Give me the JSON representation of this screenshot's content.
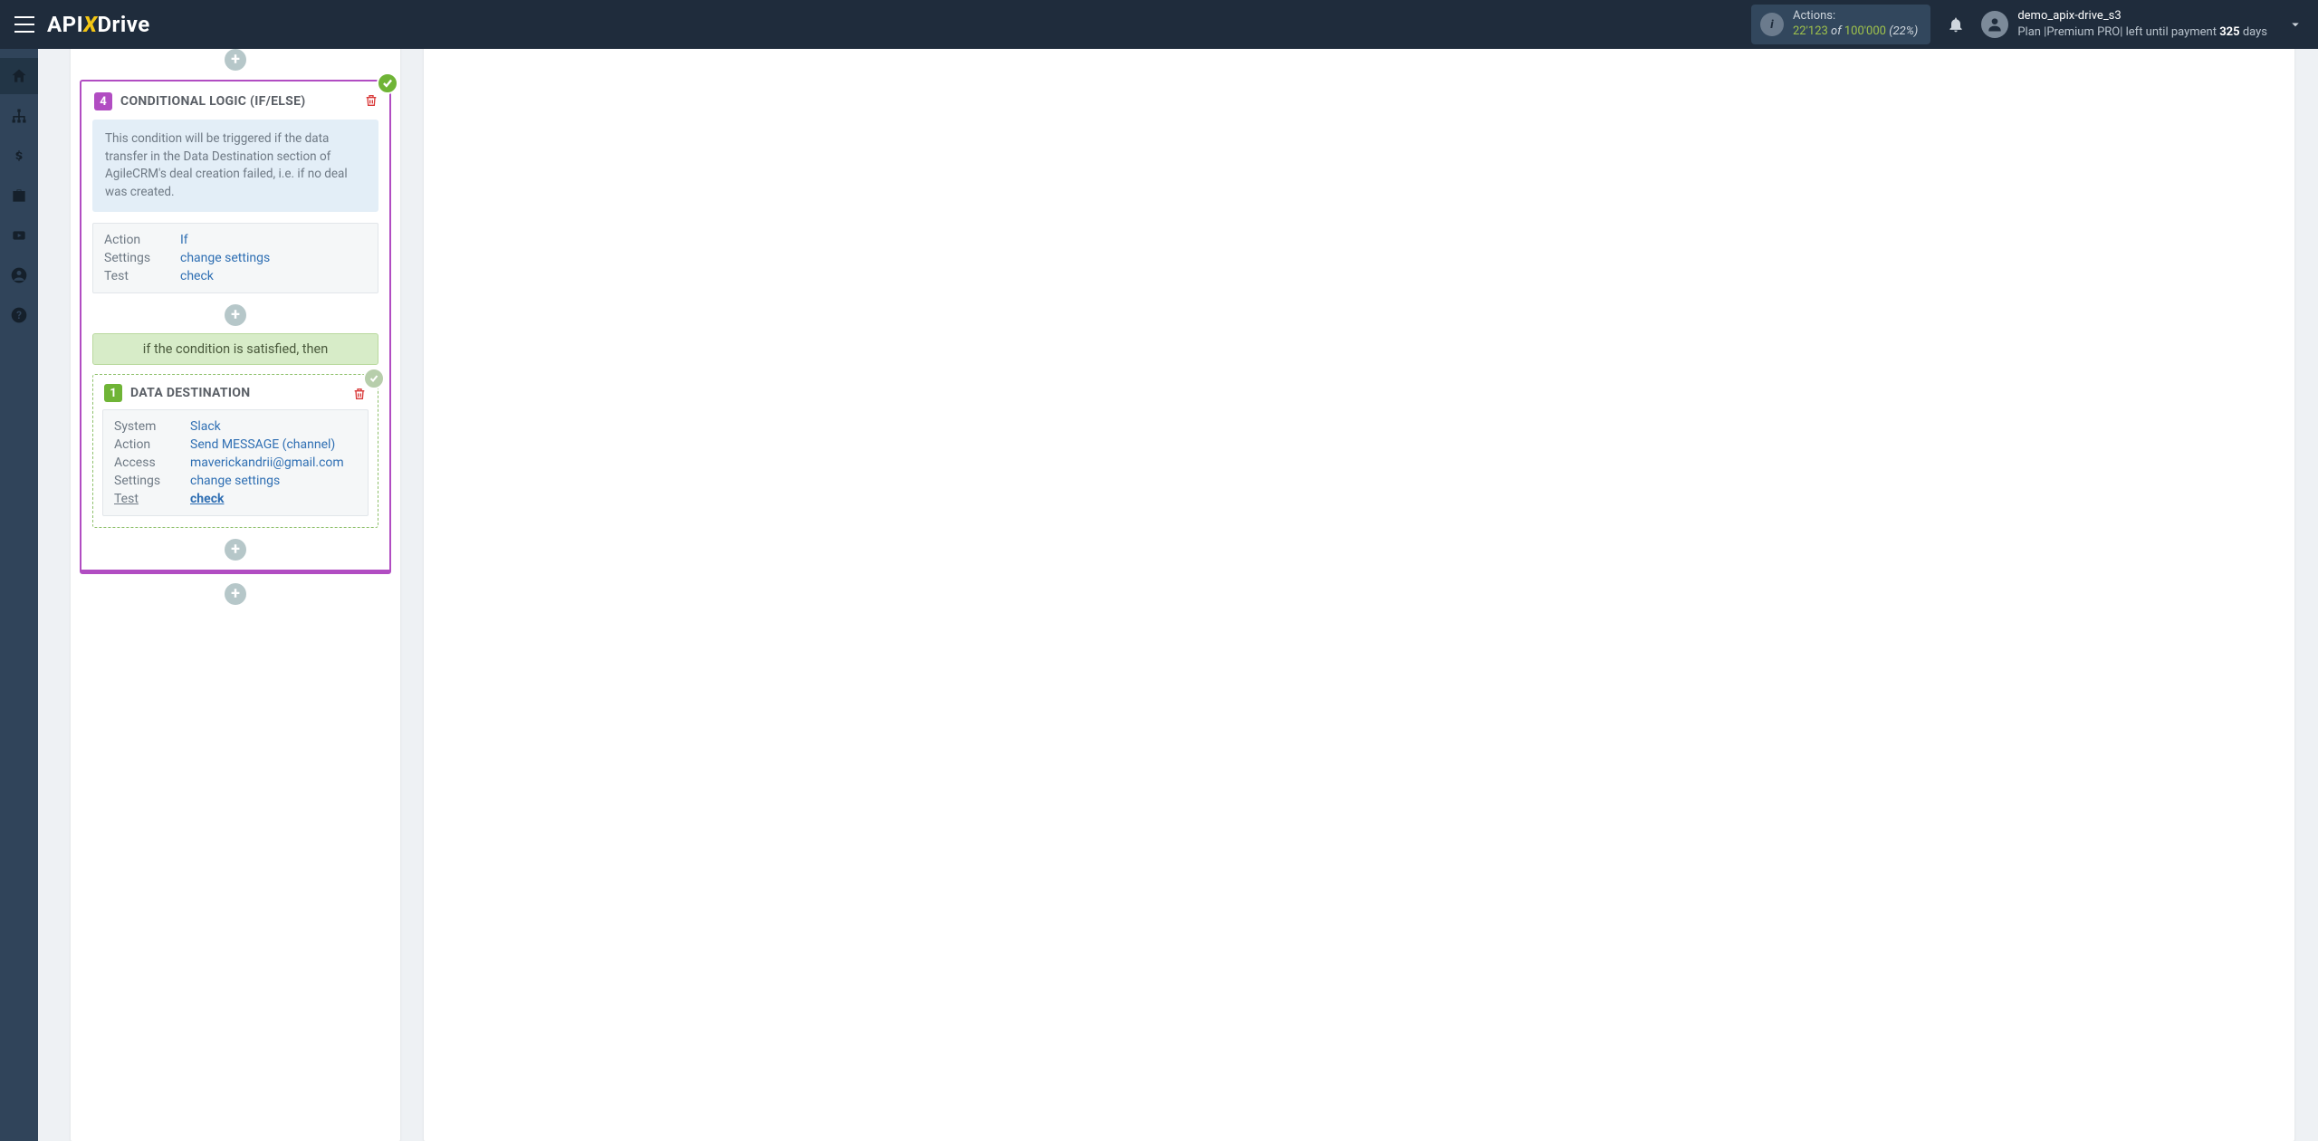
{
  "header": {
    "logo": {
      "part1": "API",
      "part2": "X",
      "part3": "Drive"
    },
    "actions": {
      "label": "Actions:",
      "used": "22'123",
      "of": "of",
      "total": "100'000",
      "pct": "(22%)"
    },
    "user": {
      "name": "demo_apix-drive_s3",
      "plan_prefix": "Plan |Premium PRO| left until payment ",
      "days": "325",
      "day_word": " days"
    }
  },
  "step4": {
    "num": "4",
    "title": "CONDITIONAL LOGIC (IF/ELSE)",
    "note": "This condition will be triggered if the data transfer in the Data Destination section of AgileCRM's deal creation failed, i.e. if no deal was created.",
    "rows": {
      "action_k": "Action",
      "action_v": "If",
      "settings_k": "Settings",
      "settings_v": "change settings",
      "test_k": "Test",
      "test_v": "check"
    },
    "banner": "if the condition is satisfied, then"
  },
  "sub": {
    "num": "1",
    "title": "DATA DESTINATION",
    "rows": {
      "system_k": "System",
      "system_v": "Slack",
      "action_k": "Action",
      "action_v": "Send MESSAGE (channel)",
      "access_k": "Access",
      "access_v": "maverickandrii@gmail.com",
      "settings_k": "Settings",
      "settings_v": "change settings",
      "test_k": "Test",
      "test_v": "check"
    }
  }
}
